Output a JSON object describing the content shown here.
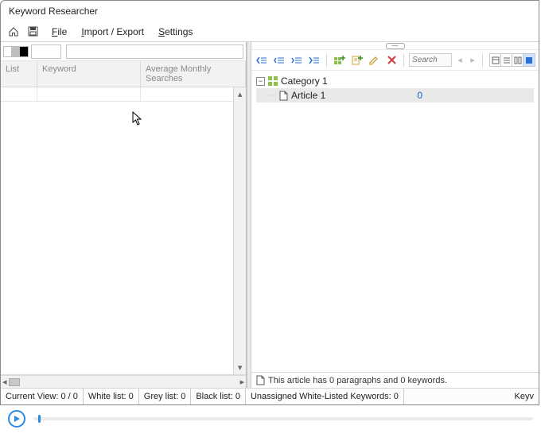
{
  "title": "Keyword Researcher",
  "menu": {
    "file_html": "File",
    "import_html": "Import / Export",
    "settings_html": "Settings"
  },
  "left": {
    "columns": {
      "list": "List",
      "keyword": "Keyword",
      "avg": "Average Monthly Searches"
    }
  },
  "right": {
    "search_placeholder": "Search",
    "tree": {
      "category": "Category 1",
      "article": "Article 1",
      "article_count": "0"
    },
    "status": "This article has 0 paragraphs and 0 keywords."
  },
  "status": {
    "current_view": "Current View: 0 / 0",
    "white": "White list: 0",
    "grey": "Grey list: 0",
    "black": "Black list: 0",
    "unassigned": "Unassigned White-Listed Keywords: 0",
    "right_trunc": "Keyv"
  }
}
